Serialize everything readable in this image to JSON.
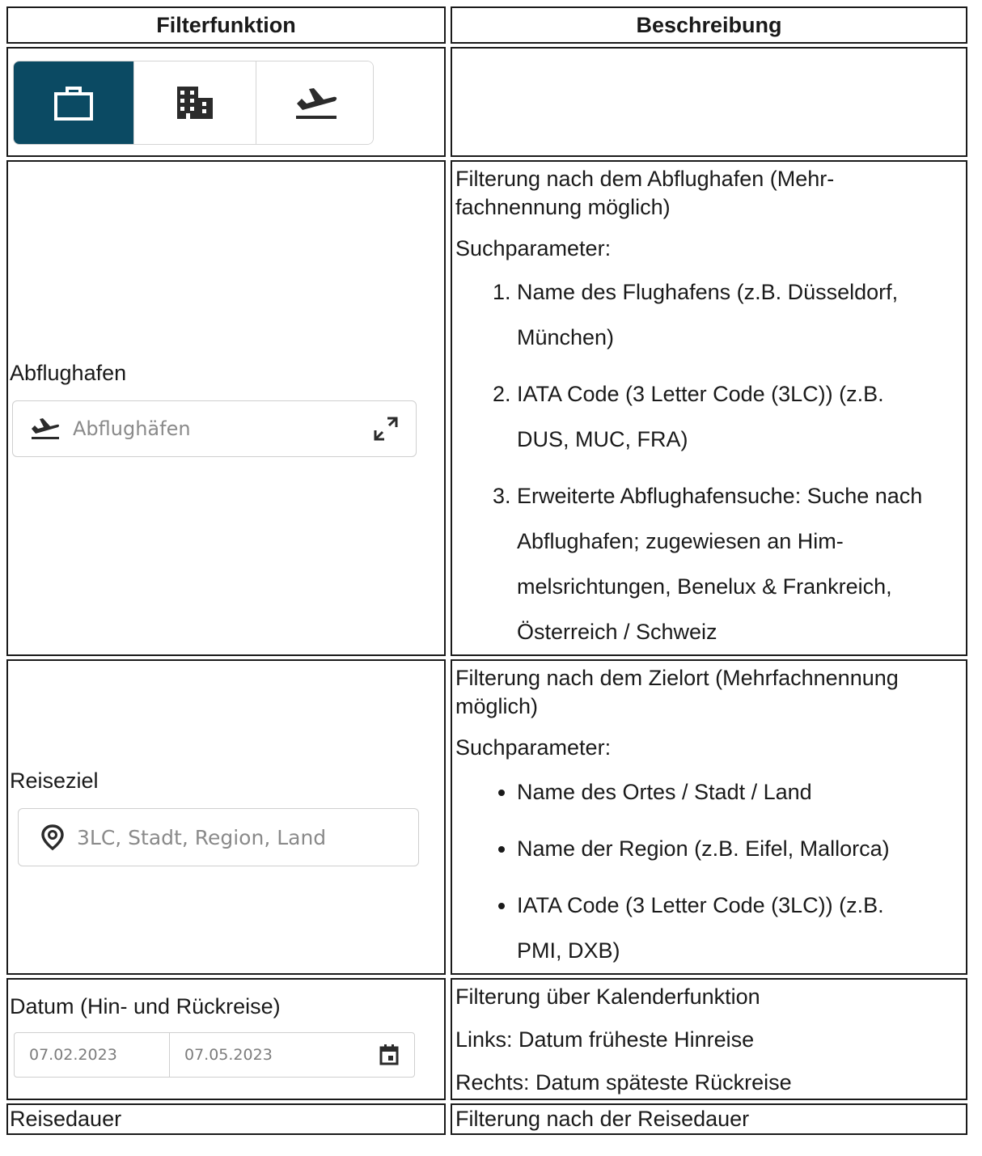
{
  "header": {
    "col1": "Filterfunktion",
    "col2": "Beschreibung"
  },
  "tabs": [
    {
      "icon": "briefcase-icon",
      "active": true
    },
    {
      "icon": "building-icon",
      "active": false
    },
    {
      "icon": "flight-departure-icon",
      "active": false
    }
  ],
  "colors": {
    "accent": "#0b4a63",
    "border": "#1a1a1a",
    "placeholder": "#8a8a8a"
  },
  "rows": {
    "abflughafen": {
      "label": "Abflughafen",
      "placeholder": "Abflughäfen",
      "desc_line1": "Filterung nach dem Abflughafen (Mehr-",
      "desc_line2": "fachnennung möglich)",
      "params_label": "Suchparameter:",
      "items": [
        {
          "line1": "Name des Flughafens (z.B. Düsseldorf,",
          "line2": "München)"
        },
        {
          "line1": "IATA Code (3 Letter Code (3LC)) (z.B.",
          "line2": "DUS, MUC, FRA)"
        },
        {
          "line1": "Erweiterte Abflughafensuche: Suche nach",
          "line2": "Abflughafen; zugewiesen an Him-",
          "line3": "melsrichtungen, Benelux & Frankreich,",
          "line4": "Österreich / Schweiz"
        }
      ]
    },
    "reiseziel": {
      "label": "Reiseziel",
      "placeholder": "3LC, Stadt, Region, Land",
      "desc_line1": "Filterung nach dem Zielort (Mehrfachnennung",
      "desc_line2": "möglich)",
      "params_label": "Suchparameter:",
      "items": [
        {
          "line1": "Name des Ortes / Stadt / Land"
        },
        {
          "line1": "Name der Region (z.B. Eifel, Mallorca)"
        },
        {
          "line1": "IATA Code (3 Letter Code (3LC)) (z.B.",
          "line2": "PMI, DXB)"
        }
      ]
    },
    "datum": {
      "label": "Datum (Hin- und Rückreise)",
      "date_from": "07.02.2023",
      "date_to": "07.05.2023",
      "desc1": "Filterung über Kalenderfunktion",
      "desc2": "Links: Datum früheste Hinreise",
      "desc3": "Rechts: Datum späteste Rückreise"
    },
    "reisedauer": {
      "label": "Reisedauer",
      "desc": "Filterung nach der Reisedauer"
    }
  }
}
